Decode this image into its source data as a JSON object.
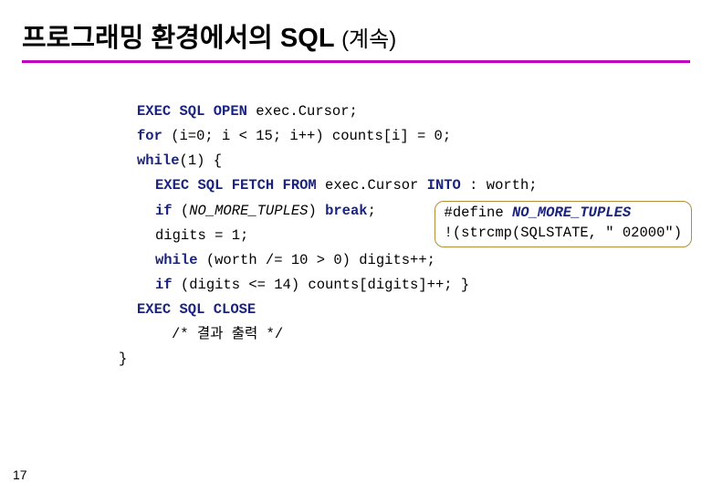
{
  "title_main": "프로그래밍 환경에서의 SQL ",
  "title_cont": "(계속)",
  "code": {
    "l1a": "EXEC SQL OPEN",
    "l1b": " exec.Cursor;",
    "l2a": "for",
    "l2b": " (i=0; i < 15; i++) counts[i] = 0;",
    "l3a": "while",
    "l3b": "(1) {",
    "l4a": "EXEC SQL FETCH FROM",
    "l4b": " exec.Cursor ",
    "l4c": "INTO",
    "l4d": " : worth;",
    "l5a": "if",
    "l5b": " (",
    "l5c": "NO_MORE_TUPLES",
    "l5d": ") ",
    "l5e": "break",
    "l5f": ";",
    "l6": "digits = 1;",
    "l7a": "while",
    "l7b": " (worth /= 10 > 0) digits++;",
    "l8a": "if",
    "l8b": " (digits <= 14) counts[digits]++; }",
    "l9": "EXEC SQL CLOSE",
    "l10": "/* 결과 출력 */",
    "close": "}"
  },
  "callout": {
    "l1a": "#define ",
    "l1b": "NO_MORE_TUPLES",
    "l2": "!(strcmp(SQLSTATE, \" 02000\")"
  },
  "page_number": "17"
}
